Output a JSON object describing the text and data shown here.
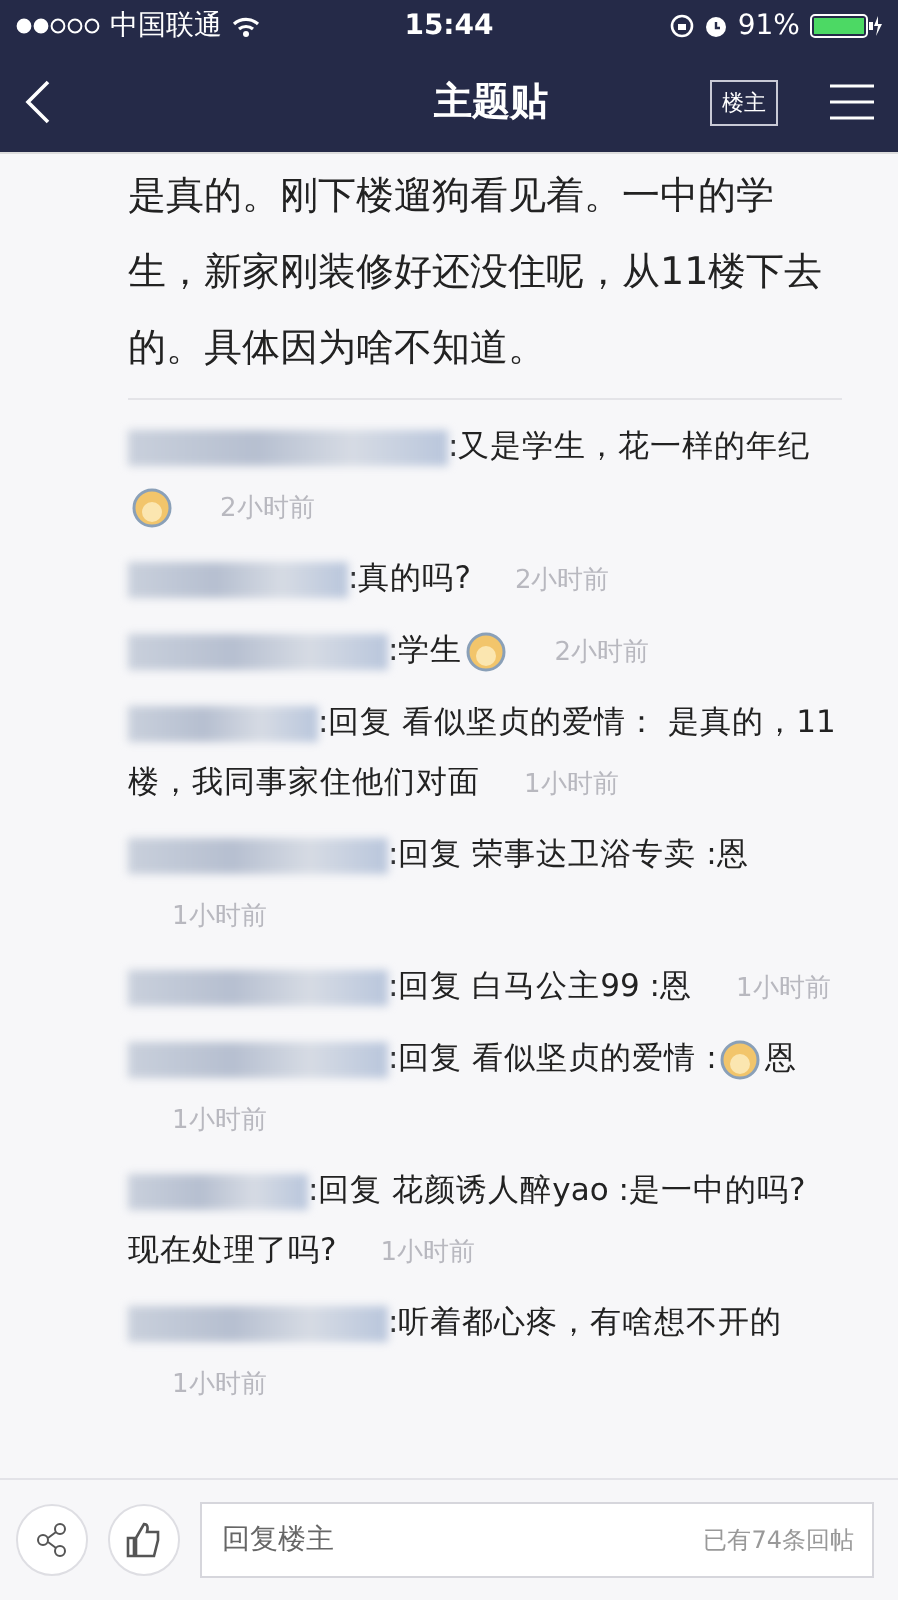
{
  "status_bar": {
    "carrier": "中国联通",
    "time": "15:44",
    "battery": "91%"
  },
  "nav": {
    "title": "主题贴",
    "owner_button": "楼主"
  },
  "post": {
    "text": "是真的。刚下楼遛狗看见着。一中的学生，新家刚装修好还没住呢，从11楼下去的。具体因为啥不知道。"
  },
  "comments": [
    {
      "parts": [
        {
          "kind": "text",
          "text": ":又是学生，花一样的年纪"
        },
        {
          "kind": "emoji"
        }
      ],
      "time": "2小时前"
    },
    {
      "parts": [
        {
          "kind": "text",
          "text": ":真的吗?"
        }
      ],
      "time": "2小时前"
    },
    {
      "parts": [
        {
          "kind": "text",
          "text": ":学生"
        },
        {
          "kind": "emoji"
        }
      ],
      "time": "2小时前"
    },
    {
      "parts": [
        {
          "kind": "text",
          "text": ":回复 看似坚贞的爱情： 是真的，11"
        },
        {
          "kind": "text",
          "text": "楼，我同事家住他们对面"
        }
      ],
      "time": "1小时前"
    },
    {
      "parts": [
        {
          "kind": "text",
          "text": ":回复 荣事达卫浴专卖 :恩"
        }
      ],
      "time": "1小时前"
    },
    {
      "parts": [
        {
          "kind": "text",
          "text": ":回复 白马公主99 :恩"
        }
      ],
      "time": "1小时前"
    },
    {
      "parts": [
        {
          "kind": "text",
          "text": ":回复 看似坚贞的爱情 :"
        },
        {
          "kind": "emoji"
        },
        {
          "kind": "text",
          "text": "恩"
        }
      ],
      "time": "1小时前"
    },
    {
      "parts": [
        {
          "kind": "text",
          "text": ":回复 花颜诱人醉yao :是一中的吗?"
        },
        {
          "kind": "text",
          "text": "现在处理了吗?"
        }
      ],
      "time": "1小时前"
    },
    {
      "parts": [
        {
          "kind": "text",
          "text": ":听着都心疼，有啥想不开的"
        }
      ],
      "time": "1小时前"
    }
  ],
  "reply_bar": {
    "placeholder": "回复楼主",
    "count": "已有74条回帖"
  }
}
